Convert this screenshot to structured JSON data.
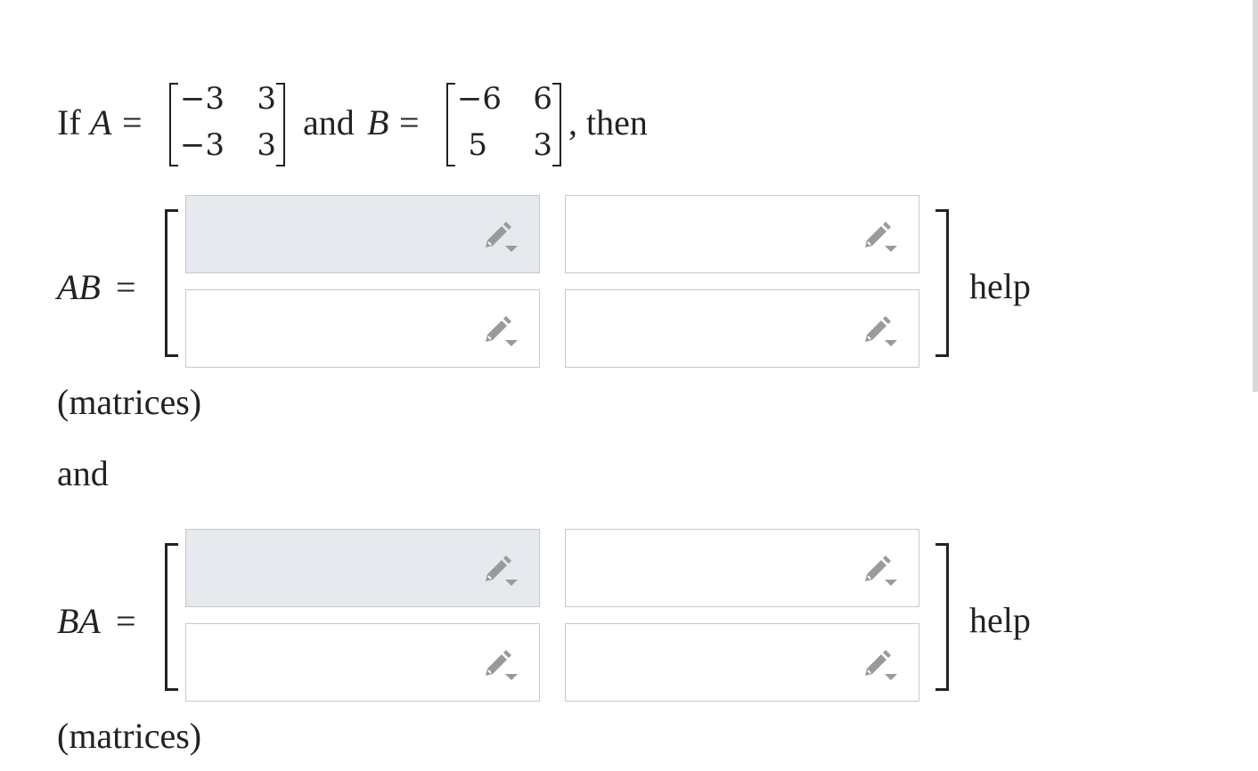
{
  "problem": {
    "intro_if": "If",
    "var_a": "A",
    "equals": "=",
    "and_label": "and",
    "var_b": "B",
    "then_label": ", then",
    "matrix_a": [
      [
        "−3",
        "3"
      ],
      [
        "−3",
        "3"
      ]
    ],
    "matrix_b": [
      [
        "−6",
        "6"
      ],
      [
        "5",
        "3"
      ]
    ]
  },
  "ab_section": {
    "lhs": "AB",
    "equals": "=",
    "entries": [
      "",
      "",
      "",
      ""
    ],
    "help_link": "help",
    "answer_type": "(matrices)"
  },
  "connector": "and",
  "ba_section": {
    "lhs": "BA",
    "equals": "=",
    "entries": [
      "",
      "",
      "",
      ""
    ],
    "help_link": "help",
    "answer_type": "(matrices)"
  },
  "icons": {
    "entry_tool": "pencil-dropdown-icon"
  },
  "colors": {
    "focused_cell": "#e6e9ed",
    "cell_border": "#c8c8c8",
    "icon": "#9a9a9a"
  }
}
